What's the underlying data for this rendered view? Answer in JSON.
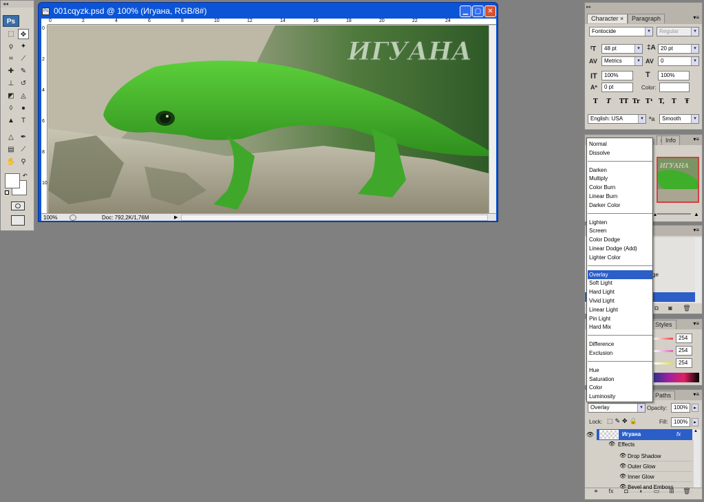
{
  "tools": {
    "collapse_glyph": "◂◂",
    "logo": "Ps",
    "items": [
      "marquee-icon",
      "move-icon",
      "lasso-icon",
      "magic-wand-icon",
      "crop-icon",
      "eyedropper-icon",
      "healing-icon",
      "brush-icon",
      "stamp-icon",
      "history-brush-icon",
      "eraser-icon",
      "bucket-icon",
      "blur-icon",
      "dodge-icon",
      "path-select-icon",
      "type-icon",
      "direct-select-icon",
      "pen-shape-icon",
      "notes-icon",
      "eyedropper2-icon",
      "hand-icon",
      "zoom-icon"
    ]
  },
  "document": {
    "title": "001cqyzk.psd @ 100% (Игуана, RGB/8#)",
    "artwork_text": "ИГУАНА",
    "ruler_top": [
      "0",
      "2",
      "4",
      "6",
      "8",
      "10",
      "12",
      "14",
      "16",
      "18",
      "20",
      "22",
      "24"
    ],
    "ruler_left": [
      "0",
      "2",
      "4",
      "6",
      "8",
      "10"
    ],
    "zoom": "100%",
    "doc_info": "Doc: 792,2K/1,76M"
  },
  "character": {
    "tabs": [
      "Character",
      "Paragraph"
    ],
    "close_glyph": "×",
    "font_family": "Fontocide",
    "font_style": "Regular",
    "font_size": "48 pt",
    "leading": "20 pt",
    "kerning": "Metrics",
    "tracking": "0",
    "vscale": "100%",
    "hscale": "100%",
    "baseline": "0 pt",
    "color_label": "Color:",
    "style_buttons": [
      "T",
      "T",
      "TT",
      "Tr",
      "T¹",
      "T,",
      "T",
      "Ŧ"
    ],
    "language": "English: USA",
    "aa_icon_text": "ªa",
    "antialias": "Smooth"
  },
  "navigator": {
    "tabs": [
      "n",
      "Info"
    ],
    "preview_text": "ИГУАНА"
  },
  "history": {
    "partial_item": "ge"
  },
  "color": {
    "tab_visible": "Styles",
    "values": [
      "254",
      "254",
      "254"
    ]
  },
  "blend_modes": {
    "groups": [
      [
        "Normal",
        "Dissolve"
      ],
      [
        "Darken",
        "Multiply",
        "Color Burn",
        "Linear Burn",
        "Darker Color"
      ],
      [
        "Lighten",
        "Screen",
        "Color Dodge",
        "Linear Dodge (Add)",
        "Lighter Color"
      ],
      [
        "Overlay",
        "Soft Light",
        "Hard Light",
        "Vivid Light",
        "Linear Light",
        "Pin Light",
        "Hard Mix"
      ],
      [
        "Difference",
        "Exclusion"
      ],
      [
        "Hue",
        "Saturation",
        "Color",
        "Luminosity"
      ]
    ],
    "selected": "Overlay"
  },
  "layers": {
    "tab_visible": "Paths",
    "blend_mode": "Overlay",
    "opacity_label": "Opacity:",
    "opacity": "100%",
    "lock_label": "Lock:",
    "fill_label": "Fill:",
    "fill": "100%",
    "layer_name": "Игуана",
    "fx_badge": "fx",
    "effects_label": "Effects",
    "effects": [
      "Drop Shadow",
      "Outer Glow",
      "Inner Glow",
      "Bevel and Emboss"
    ],
    "bottom_icons": [
      "link-icon",
      "fx-icon",
      "mask-icon",
      "adjustment-icon",
      "group-icon",
      "new-layer-icon",
      "trash-icon"
    ],
    "bottom_glyphs": [
      "⚭",
      "fx",
      "◘",
      "◐",
      "▭",
      "⊞",
      "🗑"
    ]
  }
}
